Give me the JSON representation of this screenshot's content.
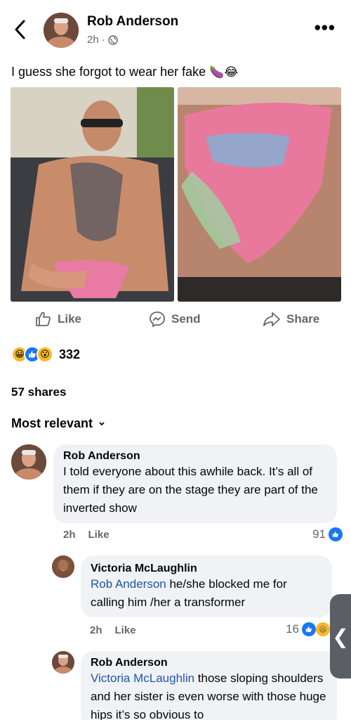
{
  "post": {
    "author": "Rob Anderson",
    "time": "2h",
    "separator": "·",
    "caption": "I guess she forgot to wear her fake",
    "caption_emoji": "🍆😂"
  },
  "actions": {
    "like": "Like",
    "send": "Send",
    "share": "Share"
  },
  "reactions": {
    "count": "332",
    "emoji_haha": "😀",
    "emoji_wow": "😮"
  },
  "shares": "57 shares",
  "sort_label": "Most relevant",
  "comments": [
    {
      "name": "Rob Anderson",
      "text": "I told everyone about this awhile back. It’s all of them if they are on the stage they are part of the inverted show",
      "time": "2h",
      "like": "Like",
      "count": "91"
    },
    {
      "name": "Victoria McLaughlin",
      "mention": "Rob Anderson",
      "text": " he/she  blocked me for calling him /her a transformer",
      "time": "2h",
      "like": "Like",
      "count": "16",
      "emoji_haha": "😆"
    },
    {
      "name": "Rob Anderson",
      "mention": "Victoria McLaughlin",
      "text": " those sloping shoulders and her sister is even worse with those huge hips it’s so obvious to"
    }
  ],
  "sidetab_glyph": "❮",
  "colors": {
    "accent": "#1877f2",
    "mention": "#1b57a8",
    "bubble": "#f0f2f5",
    "muted": "#65676b"
  }
}
